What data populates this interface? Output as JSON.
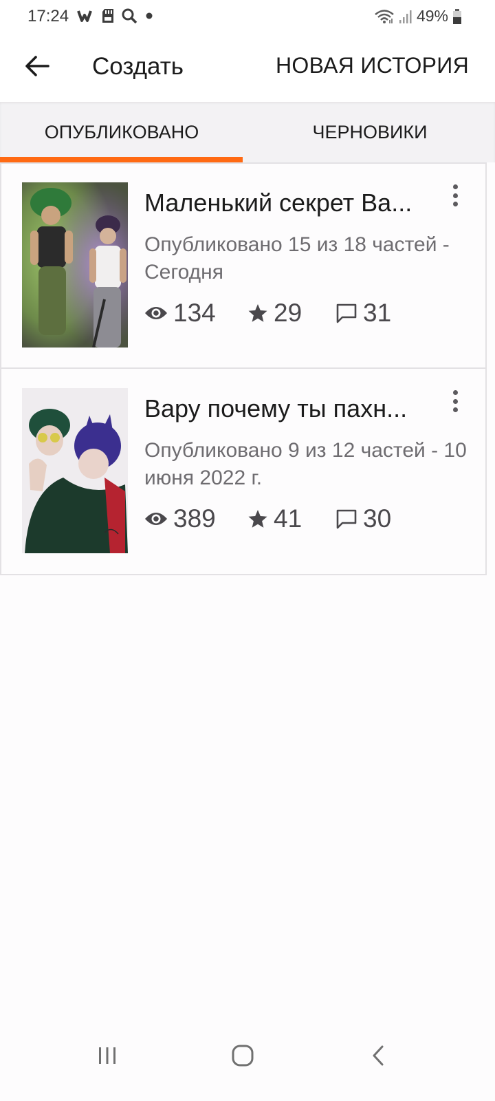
{
  "status_bar": {
    "time": "17:24",
    "battery": "49%",
    "icons": [
      "wattpad-icon",
      "sd-card-icon",
      "search-icon",
      "dot-icon",
      "wifi-icon",
      "signal-icon",
      "battery-icon"
    ]
  },
  "app_bar": {
    "title": "Создать",
    "action": "НОВАЯ ИСТОРИЯ"
  },
  "tabs": {
    "items": [
      {
        "label": "ОПУБЛИКОВАНО",
        "active": true
      },
      {
        "label": "ЧЕРНОВИКИ",
        "active": false
      }
    ]
  },
  "stories": [
    {
      "title": "Маленький секрет Ва...",
      "meta": "Опубликовано 15 из 18 частей - Сегодня",
      "views": "134",
      "votes": "29",
      "comments": "31"
    },
    {
      "title": "Вару почему ты пахн...",
      "meta": "Опубликовано 9 из 12 частей - 10 июня 2022 г.",
      "views": "389",
      "votes": "41",
      "comments": "30"
    }
  ],
  "colors": {
    "accent": "#ff6a13",
    "text_primary": "#1b1b1b",
    "text_secondary": "#6e6c70"
  }
}
